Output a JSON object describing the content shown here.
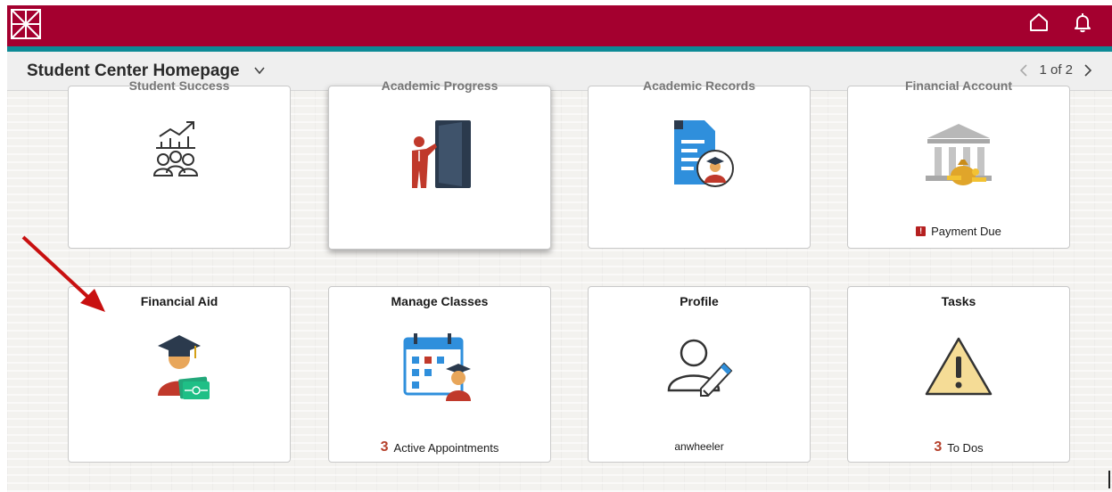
{
  "topbar": {
    "colors": {
      "brand": "#a4002f",
      "accent_line": "#0d8a96"
    },
    "logo_icon": "asterisk-grid-logo",
    "home_icon": "home-icon",
    "bell_icon": "bell-icon"
  },
  "header": {
    "title": "Student Center Homepage",
    "pager": {
      "text": "1 of 2"
    }
  },
  "tiles": [
    {
      "title": "Student Success",
      "icon": "success-chart-people-icon",
      "footer": ""
    },
    {
      "title": "Academic Progress",
      "icon": "presenter-door-icon",
      "footer": ""
    },
    {
      "title": "Academic Records",
      "icon": "document-graduate-icon",
      "footer": ""
    },
    {
      "title": "Financial Account",
      "icon": "bank-moneybag-icon",
      "footer": "Payment Due"
    },
    {
      "title": "Financial Aid",
      "icon": "graduate-cash-icon",
      "footer": ""
    },
    {
      "title": "Manage Classes",
      "icon": "calendar-graduate-icon",
      "count": "3",
      "footer": "Active Appointments"
    },
    {
      "title": "Profile",
      "icon": "user-pencil-icon",
      "footer": "anwheeler"
    },
    {
      "title": "Tasks",
      "icon": "warning-triangle-icon",
      "count": "3",
      "footer": "To Dos"
    }
  ],
  "annotation": {
    "icon": "red-arrow-pointer",
    "color": "#c81010"
  }
}
